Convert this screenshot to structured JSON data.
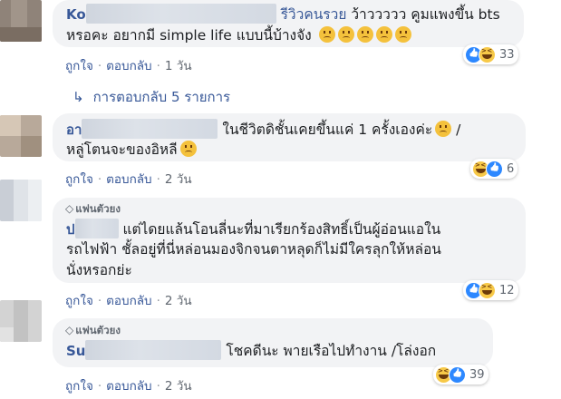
{
  "comments": [
    {
      "name_visible": "Ko",
      "text_line1_tag": "รีวิวคนรวย",
      "text_line1": " ว้าววววว คูมแพงขึ้น bts",
      "text_line2": "หรอคะ อยากมี simple life แบบนี้บ้างจัง",
      "emoji_count_inline": 5,
      "actions": {
        "like": "ถูกใจ",
        "reply": "ตอบกลับ",
        "time": "1 วัน"
      },
      "reaction_count": "33",
      "reactions": [
        "like",
        "haha"
      ]
    },
    {
      "name_visible": "อา",
      "text_line1": "ในชีวิตดิชั้นเคยขึ้นแค่ 1 ครั้งเองค่ะ",
      "text_line1_tail": " /",
      "text_line2": "หลู่โตนจะของอิหลี",
      "actions": {
        "like": "ถูกใจ",
        "reply": "ตอบกลับ",
        "time": "2 วัน"
      },
      "reaction_count": "6",
      "reactions": [
        "haha",
        "like"
      ]
    },
    {
      "fan_badge": "แฟนตัวยง",
      "name_visible": "ป",
      "text_line1": "แต่ไดยแล้นโอนลี่นะที่มาเรียกร้องสิทธิ์เป็นผู้อ่อนแอใน",
      "text_line2": "รถไฟฟ้า ชั้ลอยู่ที่นี่หล่อนมองจิกจนตาหลุดก็ไม่มีใครลุกให้หล่อน",
      "text_line3": "นั่งหรอกย่ะ",
      "actions": {
        "like": "ถูกใจ",
        "reply": "ตอบกลับ",
        "time": "2 วัน"
      },
      "reaction_count": "12",
      "reactions": [
        "like",
        "haha"
      ]
    },
    {
      "fan_badge": "แฟนตัวยง",
      "name_visible": "Su",
      "text_line1": "โชคดีนะ พายเรือไปทำงาน /โล่งอก",
      "actions": {
        "like": "ถูกใจ",
        "reply": "ตอบกลับ",
        "time": "2 วัน"
      },
      "reaction_count": "39",
      "reactions": [
        "haha",
        "like"
      ]
    }
  ],
  "replies_link": "การตอบกลับ 5 รายการ",
  "separator": "·"
}
